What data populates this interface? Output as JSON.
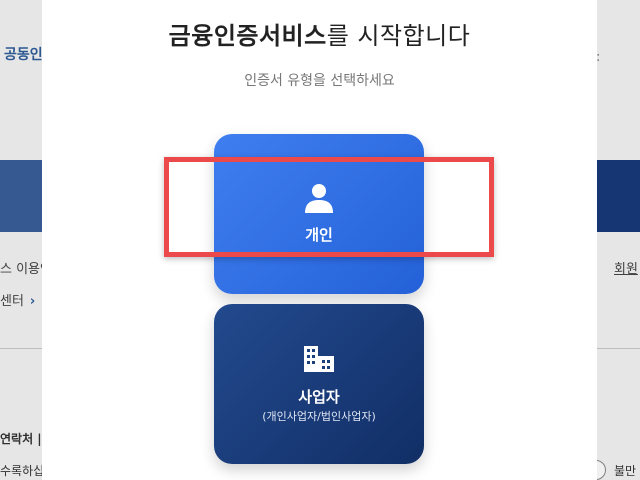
{
  "background": {
    "link_left": "공동인",
    "colon": ":",
    "text_a": "스 이용안",
    "text_b": "센터",
    "chevron": "›",
    "text_c": "회원",
    "text_d": "연락처 |",
    "text_e": "수록하십",
    "text_f": "불만"
  },
  "modal": {
    "title_strong": "금융인증서비스",
    "title_rest": "를 시작합니다",
    "subtitle": "인증서 유형을 선택하세요",
    "options": [
      {
        "label": "개인",
        "sublabel": "",
        "icon": "person-icon"
      },
      {
        "label": "사업자",
        "sublabel": "(개인사업자/법인사업자)",
        "icon": "building-icon"
      }
    ]
  },
  "colors": {
    "personal_card": "#2f6ee6",
    "business_card": "#173d7d",
    "highlight": "#ec4a4a"
  }
}
